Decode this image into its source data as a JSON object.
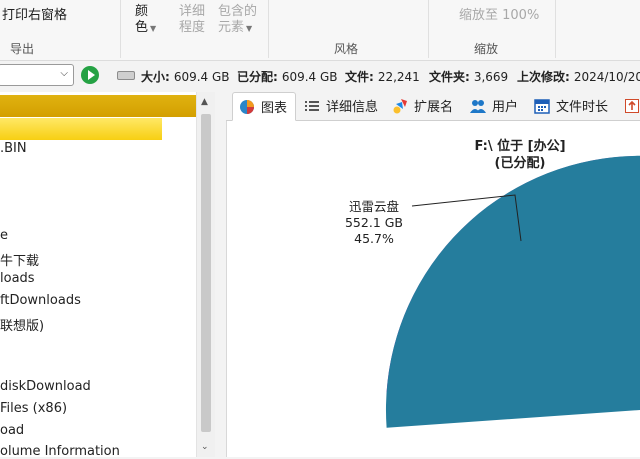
{
  "ribbon": {
    "export_items": [
      "打印右窗格"
    ],
    "export_group": "导出",
    "color_label": "颜",
    "color_label2": "色",
    "detail_label": "详细",
    "detail_label2": "程度",
    "contains_label": "包含的",
    "contains_label2": "元素",
    "style_group": "风格",
    "zoom_item": "缩放至 100%",
    "zoom_group": "缩放"
  },
  "toolbar": {
    "path_value": "",
    "size_label": "大小:",
    "size_value": "609.4 GB",
    "allocated_label": "已分配:",
    "allocated_value": "609.4 GB",
    "files_label": "文件:",
    "files_value": "22,241",
    "folders_label": "文件夹:",
    "folders_value": "3,669",
    "modified_label": "上次修改:",
    "modified_value": "2024/10/20"
  },
  "tree": {
    "items": [
      "",
      "",
      ".BIN",
      "",
      "",
      "e",
      "牛下载",
      "loads",
      "ftDownloads",
      "联想版)",
      "",
      "diskDownload",
      "Files (x86)",
      "oad",
      "olume Information"
    ]
  },
  "tabs": [
    {
      "label": "图表",
      "icon": "pie-chart-icon"
    },
    {
      "label": "详细信息",
      "icon": "list-icon"
    },
    {
      "label": "扩展名",
      "icon": "extensions-icon"
    },
    {
      "label": "用户",
      "icon": "users-icon"
    },
    {
      "label": "文件时长",
      "icon": "calendar-icon"
    }
  ],
  "chart_title_line1": "F:\\  位于 [办公]",
  "chart_title_line2": "(已分配)",
  "chart_data": {
    "type": "pie",
    "title": "F:\\  位于 [办公] (已分配)",
    "slices": [
      {
        "label": "迅雷云盘",
        "value_text": "552.1 GB",
        "percent": 45.7,
        "color": "#257d9d"
      },
      {
        "label": "",
        "percent": null,
        "color": "#2bb8b8"
      },
      {
        "label": "",
        "percent": null,
        "color": "#f1d2a0"
      },
      {
        "label": "",
        "percent": null,
        "color": "#c9c9c9"
      },
      {
        "label": "",
        "percent": null,
        "color": "#c300c3"
      }
    ]
  },
  "callout": {
    "name": "迅雷云盘",
    "size": "552.1 GB",
    "percent": "45.7%"
  },
  "colors": {
    "selection_dark": "#d9a800",
    "selection_light": "#fbe04a",
    "pie_blue": "#257d9d",
    "pie_magenta": "#c300c3"
  }
}
